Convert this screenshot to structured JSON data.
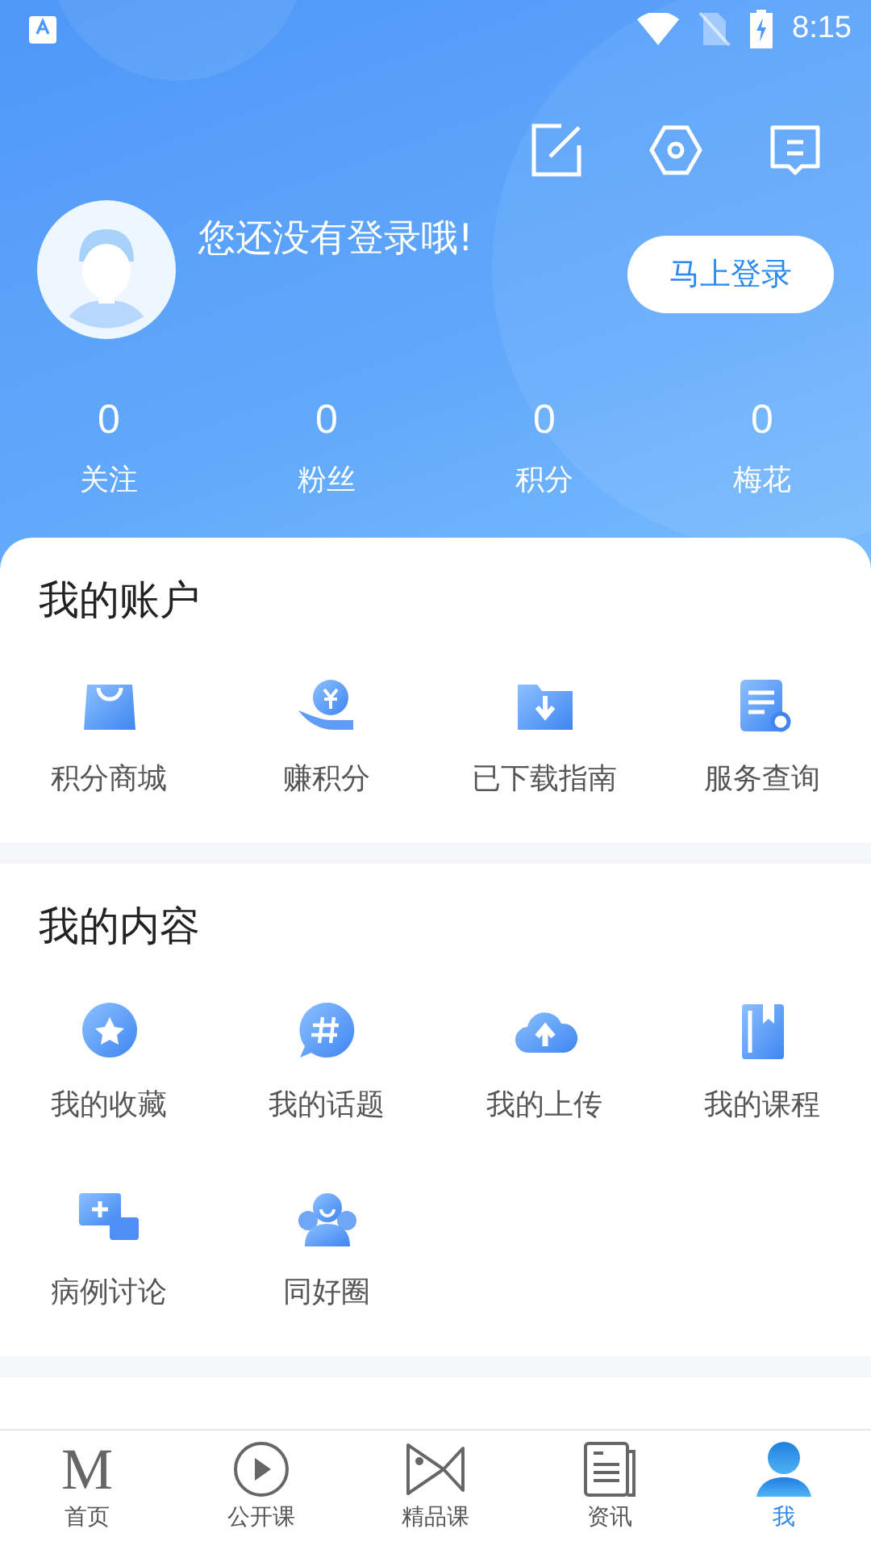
{
  "status_bar": {
    "time": "8:15"
  },
  "profile": {
    "message": "您还没有登录哦!",
    "login_button": "马上登录"
  },
  "stats": [
    {
      "value": "0",
      "label": "关注"
    },
    {
      "value": "0",
      "label": "粉丝"
    },
    {
      "value": "0",
      "label": "积分"
    },
    {
      "value": "0",
      "label": "梅花"
    }
  ],
  "sections": [
    {
      "title": "我的账户",
      "items": [
        "积分商城",
        "赚积分",
        "已下载指南",
        "服务查询"
      ]
    },
    {
      "title": "我的内容",
      "items": [
        "我的收藏",
        "我的话题",
        "我的上传",
        "我的课程",
        "病例讨论",
        "同好圈"
      ]
    }
  ],
  "tab_bar": [
    {
      "label": "首页",
      "glyph": "M",
      "selected": false
    },
    {
      "label": "公开课",
      "selected": false
    },
    {
      "label": "精品课",
      "selected": false
    },
    {
      "label": "资讯",
      "selected": false
    },
    {
      "label": "我",
      "selected": true
    }
  ]
}
